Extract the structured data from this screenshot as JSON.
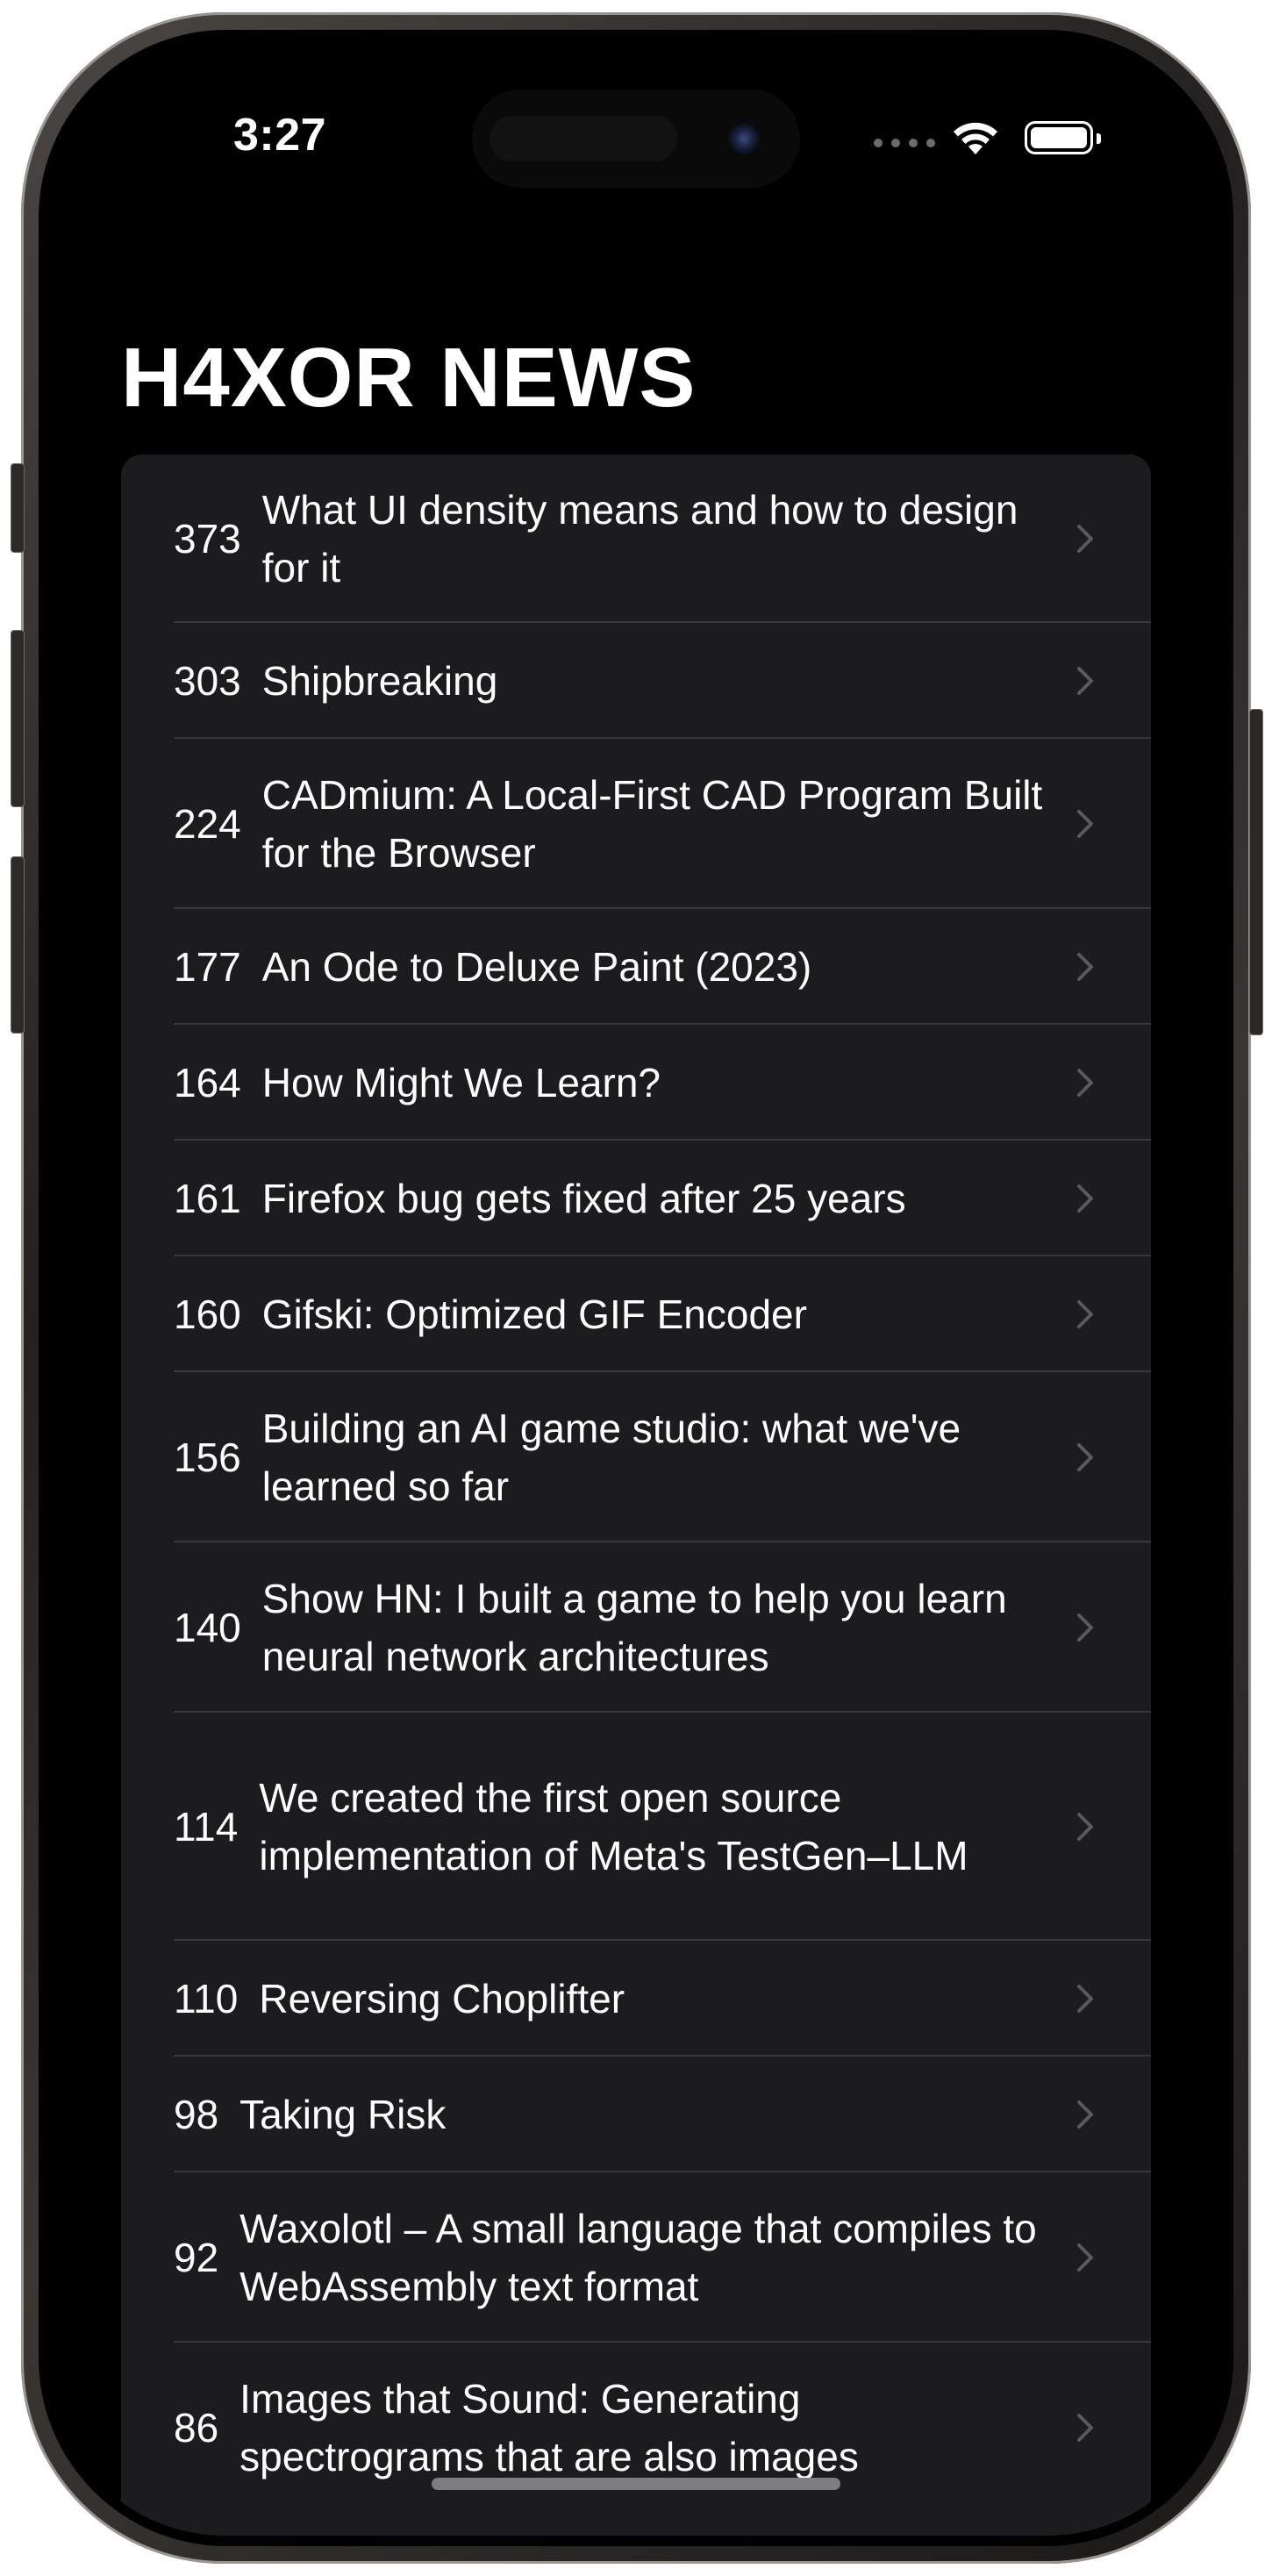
{
  "status_bar": {
    "time": "3:27"
  },
  "app": {
    "title": "H4XOR NEWS"
  },
  "stories": [
    {
      "score": "373",
      "title": "What UI density means and how to design for it"
    },
    {
      "score": "303",
      "title": "Shipbreaking"
    },
    {
      "score": "224",
      "title": "CADmium: A Local-First CAD Program Built for the Browser"
    },
    {
      "score": "177",
      "title": "An Ode to Deluxe Paint (2023)"
    },
    {
      "score": "164",
      "title": "How Might We Learn?"
    },
    {
      "score": "161",
      "title": "Firefox bug gets fixed after 25 years"
    },
    {
      "score": "160",
      "title": "Gifski: Optimized GIF Encoder"
    },
    {
      "score": "156",
      "title": "Building an AI game studio: what we've learned so far"
    },
    {
      "score": "140",
      "title": "Show HN: I built a game to help you learn neural network architectures"
    },
    {
      "score": "114",
      "title": "We created the first open source implementation of Meta's TestGen–LLM"
    },
    {
      "score": "110",
      "title": "Reversing Choplifter"
    },
    {
      "score": "98",
      "title": "Taking Risk"
    },
    {
      "score": "92",
      "title": "Waxolotl – A small language that compiles to WebAssembly text format"
    },
    {
      "score": "86",
      "title": "Images that Sound: Generating spectrograms that are also images"
    }
  ],
  "icons": {
    "row_accessory": "chevron-right-icon",
    "wifi": "wifi-icon",
    "battery": "battery-icon",
    "signal": "cellular-signal-icon"
  },
  "colors": {
    "background": "#000000",
    "cell_background": "#1c1c1e",
    "separator": "#38383a",
    "chevron": "#5a5a5e",
    "text": "#ffffff"
  }
}
